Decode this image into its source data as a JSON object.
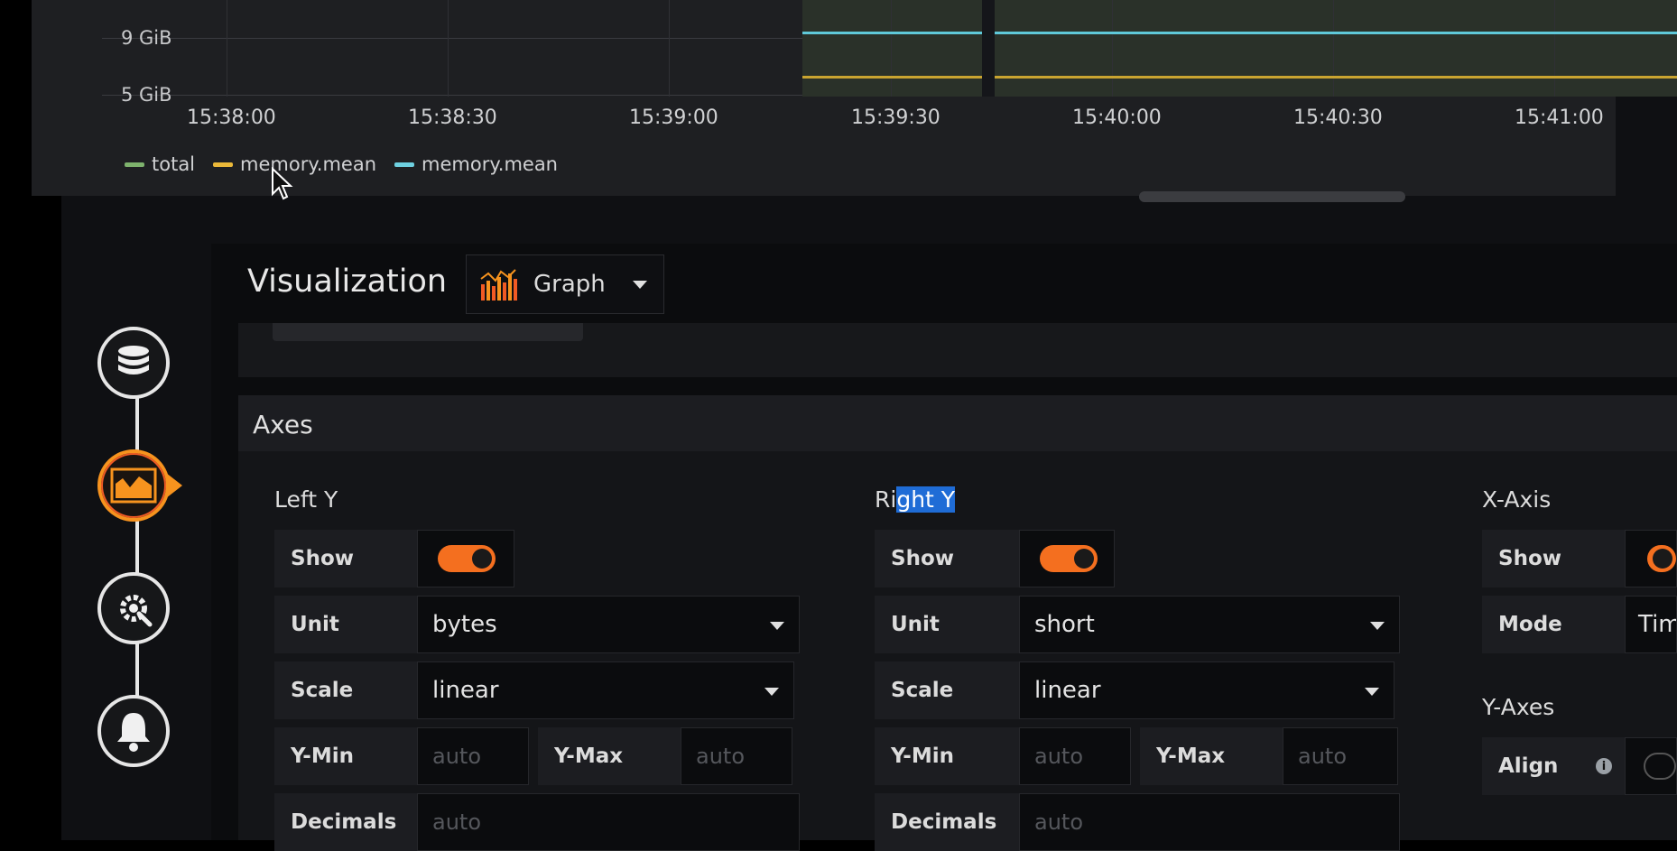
{
  "graph": {
    "y_ticks": [
      "9 GiB",
      "5 GiB"
    ],
    "x_ticks": [
      "15:38:00",
      "15:38:30",
      "15:39:00",
      "15:39:30",
      "15:40:00",
      "15:40:30",
      "15:41:00"
    ],
    "legend": [
      {
        "label": "total",
        "color": "#7eb26d"
      },
      {
        "label": "memory.mean",
        "color": "#eab839"
      },
      {
        "label": "memory.mean",
        "color": "#6ed0e0"
      }
    ]
  },
  "visualization": {
    "title": "Visualization",
    "type": "Graph"
  },
  "steps": [
    {
      "icon": "database-icon"
    },
    {
      "icon": "chart-area-icon",
      "active": true
    },
    {
      "icon": "gear-wrench-icon"
    },
    {
      "icon": "bell-icon"
    }
  ],
  "axes": {
    "title": "Axes",
    "left_y": {
      "title": "Left Y",
      "show_label": "Show",
      "unit_label": "Unit",
      "unit": "bytes",
      "scale_label": "Scale",
      "scale": "linear",
      "ymin_label": "Y-Min",
      "ymin_ph": "auto",
      "ymax_label": "Y-Max",
      "ymax_ph": "auto",
      "decimals_label": "Decimals",
      "decimals_ph": "auto"
    },
    "right_y": {
      "title_pre": "Ri",
      "title_sel": "ght Y",
      "show_label": "Show",
      "unit_label": "Unit",
      "unit": "short",
      "scale_label": "Scale",
      "scale": "linear",
      "ymin_label": "Y-Min",
      "ymin_ph": "auto",
      "ymax_label": "Y-Max",
      "ymax_ph": "auto",
      "decimals_label": "Decimals",
      "decimals_ph": "auto"
    },
    "x_axis": {
      "title": "X-Axis",
      "show_label": "Show",
      "mode_label": "Mode",
      "mode": "Tim",
      "y_axes_title": "Y-Axes",
      "align_label": "Align"
    }
  }
}
